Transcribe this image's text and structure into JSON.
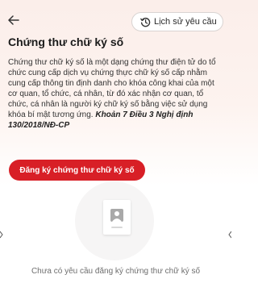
{
  "header": {
    "back_icon": "arrow-left-icon",
    "history_icon": "clock-history-icon",
    "history_label": "Lịch sử yêu cầu"
  },
  "page": {
    "title": "Chứng thư chữ ký số",
    "description": "Chứng thư chữ ký số là một dạng chứng thư điện tử do tổ chức cung cấp dịch vụ chứng thực chữ ký số cấp nhằm cung cấp thông tin định danh cho khóa công khai của một cơ quan, tổ chức, cá nhân, từ đó xác nhận cơ quan, tổ chức, cá nhân là người ký chữ ký số bằng việc sử dụng khóa bí mật tương ứng.",
    "legal_reference": "Khoản 7 Điều 3 Nghị định 130/2018/NĐ-CP",
    "register_label": "Đăng ký chứng thư chữ ký số"
  },
  "empty_state": {
    "illustration_icon": "document-portrait-icon",
    "message": "Chưa có yêu cầu đăng ký chứng thư chữ ký số"
  },
  "colors": {
    "accent": "#d81f26",
    "background_top": "#fbeeea"
  }
}
